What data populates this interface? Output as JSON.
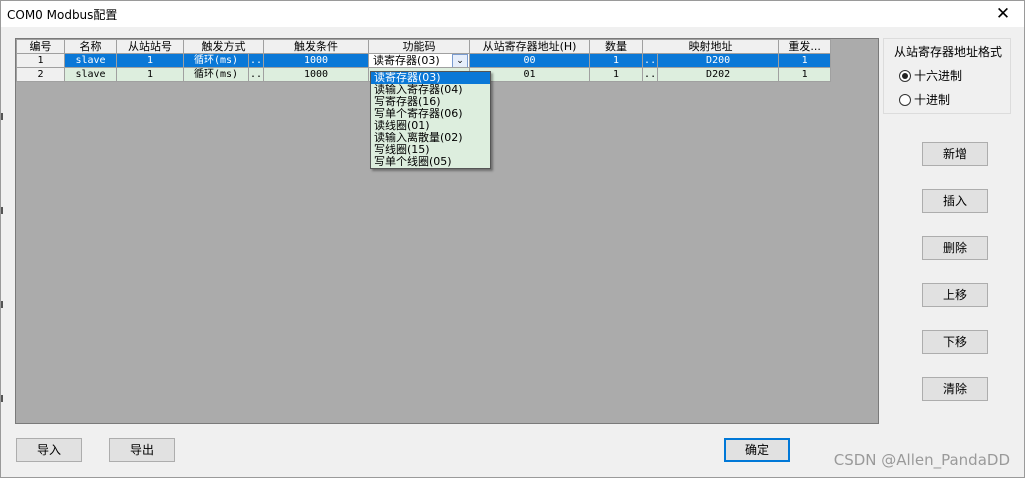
{
  "window": {
    "title": "COM0 Modbus配置",
    "close_glyph": "✕"
  },
  "grid": {
    "columns": [
      "编号",
      "名称",
      "从站站号",
      "触发方式",
      "",
      "触发条件",
      "功能码",
      "从站寄存器地址(H)",
      "数量",
      "",
      "映射地址",
      "重发..."
    ],
    "rows": [
      {
        "no": "1",
        "name": "slave",
        "station": "1",
        "trigger": "循环(ms)",
        "trig_btn": "..",
        "condition": "1000",
        "func": "读寄存器(03)",
        "addr": "00",
        "count": "1",
        "map_btn": "..",
        "map": "D200",
        "retry": "1",
        "selected": true
      },
      {
        "no": "2",
        "name": "slave",
        "station": "1",
        "trigger": "循环(ms)",
        "trig_btn": "..",
        "condition": "1000",
        "func": "",
        "addr": "01",
        "count": "1",
        "map_btn": "..",
        "map": "D202",
        "retry": "1",
        "selected": false
      }
    ]
  },
  "function_dropdown": {
    "options": [
      "读寄存器(03)",
      "读输入寄存器(04)",
      "写寄存器(16)",
      "写单个寄存器(06)",
      "读线圈(01)",
      "读输入离散量(02)",
      "写线圈(15)",
      "写单个线圈(05)"
    ],
    "highlighted_index": 0,
    "arrow_glyph": "⌄"
  },
  "address_format": {
    "title": "从站寄存器地址格式",
    "options": [
      {
        "label": "十六进制",
        "checked": true
      },
      {
        "label": "十进制",
        "checked": false
      }
    ]
  },
  "side_buttons": {
    "add": "新增",
    "insert": "插入",
    "delete": "删除",
    "move_up": "上移",
    "move_down": "下移",
    "clear": "清除"
  },
  "bottom_buttons": {
    "import": "导入",
    "export": "导出",
    "ok": "确定"
  },
  "watermark": "CSDN @Allen_PandaDD",
  "colors": {
    "selection": "#0a78d7",
    "row_bg": "#ddeede",
    "grid_bg": "#ababab"
  }
}
